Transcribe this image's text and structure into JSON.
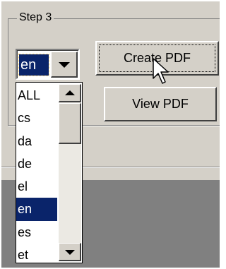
{
  "group": {
    "label": "Step 3"
  },
  "language_combo": {
    "selected": "en",
    "options": [
      "ALL",
      "cs",
      "da",
      "de",
      "el",
      "en",
      "es",
      "et"
    ],
    "selected_option": "en"
  },
  "buttons": {
    "create_pdf": "Create PDF",
    "view_pdf": "View PDF"
  },
  "icons": {
    "combo_arrow": "chevron-down-icon",
    "scroll_up": "arrow-up-icon",
    "scroll_down": "arrow-down-icon",
    "cursor": "mouse-pointer-icon"
  },
  "colors": {
    "window_bg": "#d4d0c8",
    "selection_bg": "#0a246a",
    "selection_text": "#ffffff",
    "lower_panel_bg": "#808080"
  }
}
